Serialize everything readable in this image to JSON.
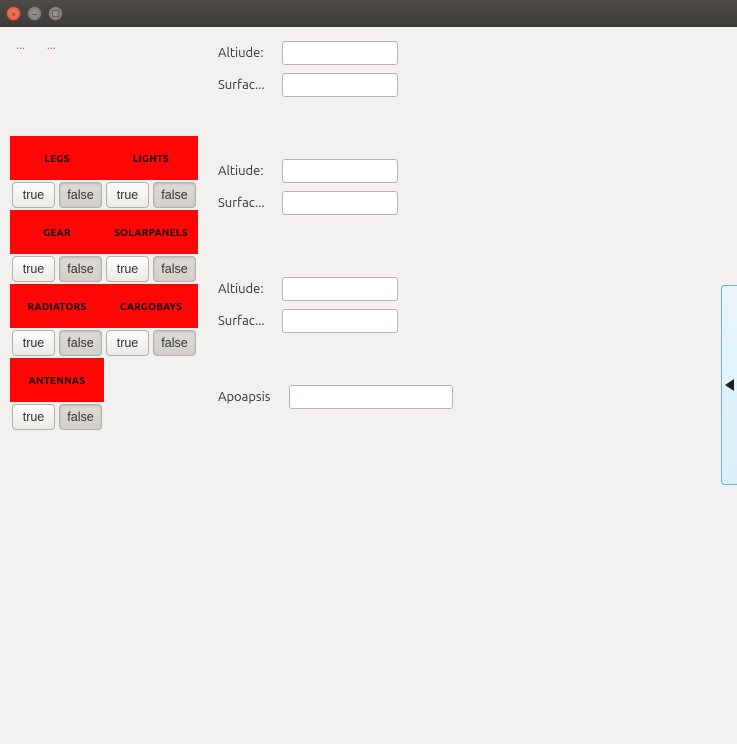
{
  "titlebar": {
    "close": "×",
    "min": "–",
    "max": "▢"
  },
  "left": {
    "ellipsis_a": "...",
    "ellipsis_b": "...",
    "tiles": [
      {
        "label": "LEGS",
        "true": "true",
        "false": "false"
      },
      {
        "label": "LIGHTS",
        "true": "true",
        "false": "false"
      },
      {
        "label": "GEAR",
        "true": "true",
        "false": "false"
      },
      {
        "label": "SOLARPANELS",
        "true": "true",
        "false": "false"
      },
      {
        "label": "RADIATORS",
        "true": "true",
        "false": "false"
      },
      {
        "label": "CARGOBAYS",
        "true": "true",
        "false": "false"
      },
      {
        "label": "ANTENNAS",
        "true": "true",
        "false": "false"
      }
    ]
  },
  "right": {
    "group1": {
      "altitude_label": "Altiude:",
      "surface_label": "Surfac...",
      "altitude_val": "",
      "surface_val": ""
    },
    "group2": {
      "altitude_label": "Altiude:",
      "surface_label": "Surfac...",
      "altitude_val": "",
      "surface_val": ""
    },
    "group3": {
      "altitude_label": "Altiude:",
      "surface_label": "Surfac...",
      "altitude_val": "",
      "surface_val": ""
    },
    "apoapsis": {
      "label": "Apoapsis",
      "val": ""
    }
  }
}
